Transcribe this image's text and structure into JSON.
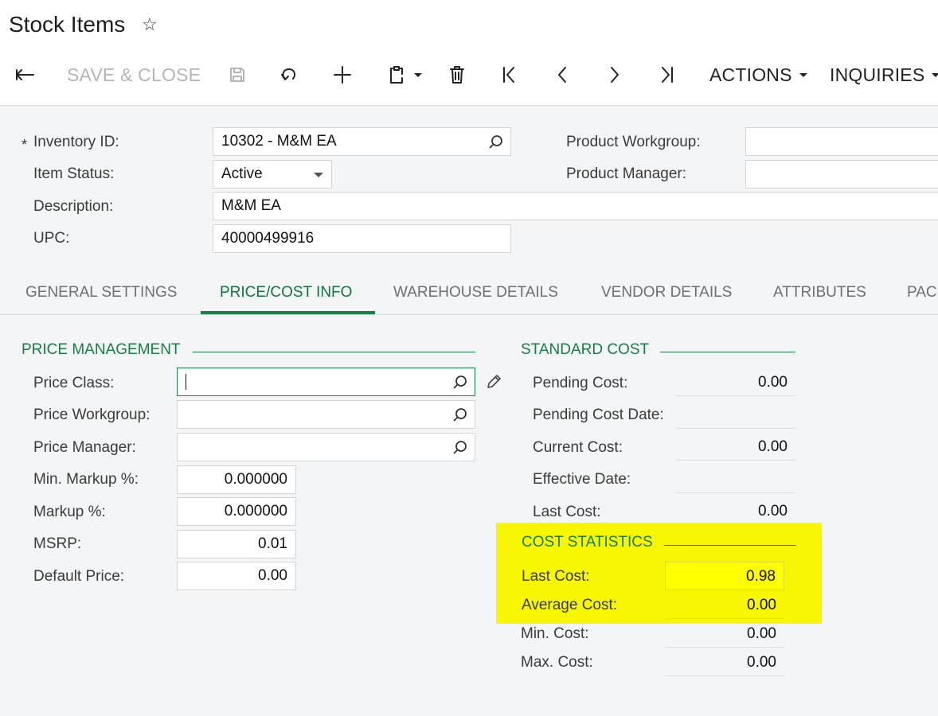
{
  "header": {
    "title": "Stock Items",
    "toolbar": {
      "save_close": "SAVE & CLOSE",
      "actions": "ACTIONS",
      "inquiries": "INQUIRIES"
    }
  },
  "summary": {
    "inventory_id": {
      "label": "Inventory ID:",
      "required": "*",
      "value": "10302 - M&M EA"
    },
    "item_status": {
      "label": "Item Status:",
      "value": "Active"
    },
    "description": {
      "label": "Description:",
      "value": "M&M EA"
    },
    "upc": {
      "label": "UPC:",
      "value": "40000499916"
    },
    "product_workgroup": {
      "label": "Product Workgroup:",
      "value": ""
    },
    "product_manager": {
      "label": "Product Manager:",
      "value": ""
    }
  },
  "tabs": [
    {
      "label": "GENERAL SETTINGS",
      "active": false
    },
    {
      "label": "PRICE/COST INFO",
      "active": true
    },
    {
      "label": "WAREHOUSE DETAILS",
      "active": false
    },
    {
      "label": "VENDOR DETAILS",
      "active": false
    },
    {
      "label": "ATTRIBUTES",
      "active": false
    },
    {
      "label": "PAC",
      "active": false
    }
  ],
  "price_management": {
    "title": "PRICE MANAGEMENT",
    "price_class": {
      "label": "Price Class:",
      "value": ""
    },
    "price_workgroup": {
      "label": "Price Workgroup:",
      "value": ""
    },
    "price_manager": {
      "label": "Price Manager:",
      "value": ""
    },
    "min_markup": {
      "label": "Min. Markup %:",
      "value": "0.000000"
    },
    "markup": {
      "label": "Markup %:",
      "value": "0.000000"
    },
    "msrp": {
      "label": "MSRP:",
      "value": "0.01"
    },
    "default_price": {
      "label": "Default Price:",
      "value": "0.00"
    }
  },
  "standard_cost": {
    "title": "STANDARD COST",
    "pending_cost": {
      "label": "Pending Cost:",
      "value": "0.00"
    },
    "pending_cost_date": {
      "label": "Pending Cost Date:",
      "value": ""
    },
    "current_cost": {
      "label": "Current Cost:",
      "value": "0.00"
    },
    "effective_date": {
      "label": "Effective Date:",
      "value": ""
    },
    "last_cost": {
      "label": "Last Cost:",
      "value": "0.00"
    }
  },
  "cost_statistics": {
    "title": "COST STATISTICS",
    "last_cost": {
      "label": "Last Cost:",
      "value": "0.98"
    },
    "average_cost": {
      "label": "Average Cost:",
      "value": "0.00"
    },
    "min_cost": {
      "label": "Min. Cost:",
      "value": "0.00"
    },
    "max_cost": {
      "label": "Max. Cost:",
      "value": "0.00"
    }
  },
  "colors": {
    "accent_green": "#1a7d45",
    "highlight_yellow": "#f6f700"
  }
}
